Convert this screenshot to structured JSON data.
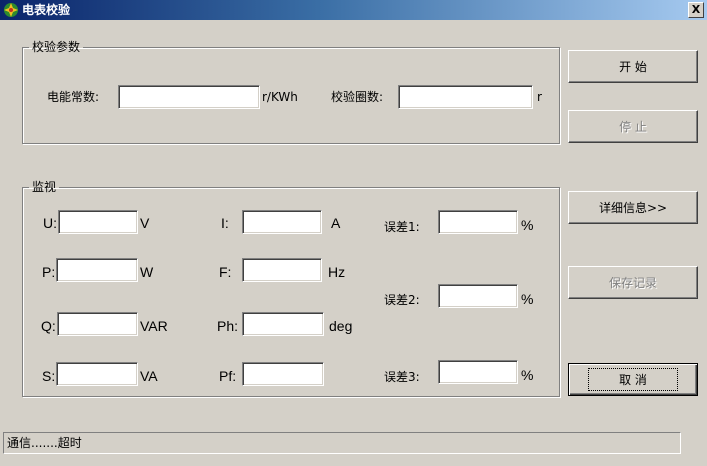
{
  "window": {
    "title": "电表校验",
    "close_label": "X",
    "icon": "app-icon"
  },
  "params": {
    "legend": "校验参数",
    "meter_const_label": "电能常数:",
    "meter_const_value": "",
    "meter_const_unit": "r/KWh",
    "turns_label": "校验圈数:",
    "turns_value": "",
    "turns_unit": "r"
  },
  "monitor": {
    "legend": "监视",
    "u": {
      "label": "U:",
      "value": "",
      "unit": "V"
    },
    "p": {
      "label": "P:",
      "value": "",
      "unit": "W"
    },
    "q": {
      "label": "Q:",
      "value": "",
      "unit": "VAR"
    },
    "s": {
      "label": "S:",
      "value": "",
      "unit": "VA"
    },
    "i": {
      "label": "I:",
      "value": "",
      "unit": "A"
    },
    "f": {
      "label": "F:",
      "value": "",
      "unit": "Hz"
    },
    "ph": {
      "label": "Ph:",
      "value": "",
      "unit": "deg"
    },
    "pf": {
      "label": "Pf:",
      "value": ""
    },
    "err1": {
      "label": "误差1:",
      "value": "",
      "unit": "%"
    },
    "err2": {
      "label": "误差2:",
      "value": "",
      "unit": "%"
    },
    "err3": {
      "label": "误差3:",
      "value": "",
      "unit": "%"
    }
  },
  "buttons": {
    "start": "开 始",
    "stop": "停 止",
    "details": "详细信息>>",
    "save": "保存记录",
    "cancel": "取 消"
  },
  "status": {
    "text": "通信.......超时"
  }
}
